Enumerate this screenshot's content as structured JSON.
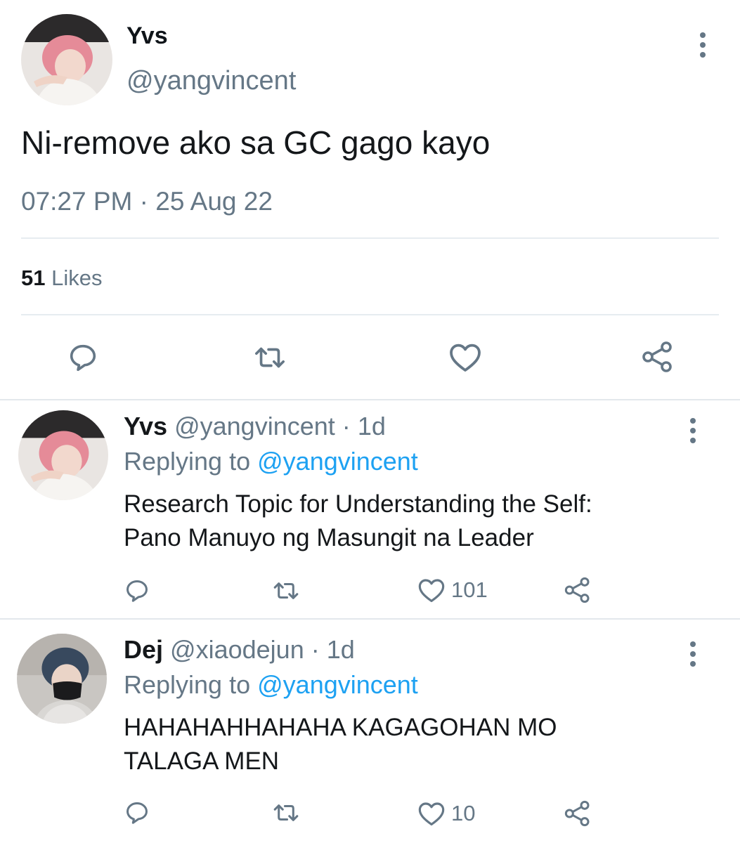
{
  "tweet": {
    "name": "Yvs",
    "handle": "@yangvincent",
    "text": "Ni-remove ako sa GC gago kayo",
    "time": "07:27 PM",
    "date": "25 Aug 22",
    "time_sep": "·",
    "likes_count": "51",
    "likes_label": "Likes"
  },
  "replies": [
    {
      "name": "Yvs",
      "handle": "@yangvincent",
      "sep": "·",
      "age": "1d",
      "replying_label": "Replying to",
      "replying_to": "@yangvincent",
      "text_lines": [
        "Research Topic for Understanding the Self:",
        "Pano Manuyo ng Masungit na Leader"
      ],
      "like_count": "101"
    },
    {
      "name": "Dej",
      "handle": "@xiaodejun",
      "sep": "·",
      "age": "1d",
      "replying_label": "Replying to",
      "replying_to": "@yangvincent",
      "text_lines": [
        "HAHAHAHHAHAHA KAGAGOHAN MO",
        "TALAGA MEN"
      ],
      "like_count": "10"
    }
  ],
  "icons": [
    "more-vertical-icon",
    "reply-icon",
    "retweet-icon",
    "heart-icon",
    "share-icon"
  ],
  "colors": {
    "accent": "#1da1f2",
    "secondary_text": "#657786",
    "primary_text": "#14171a",
    "divider": "#e6ecf0"
  }
}
